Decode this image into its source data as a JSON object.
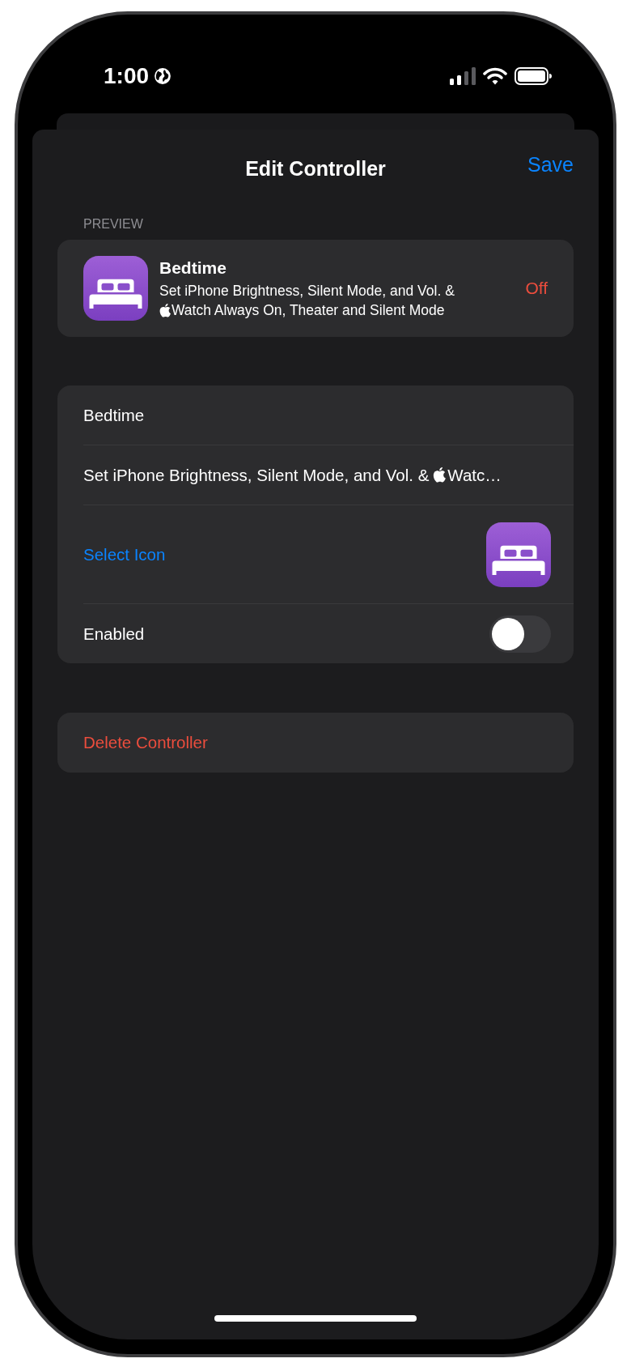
{
  "status_bar": {
    "time": "1:00"
  },
  "header": {
    "title": "Edit Controller",
    "save": "Save"
  },
  "preview": {
    "label": "PREVIEW",
    "title": "Bedtime",
    "before_logo": "Set iPhone Brightness, Silent Mode, and Vol. &",
    "after_logo": "Watch Always On, Theater and Silent Mode",
    "state": "Off"
  },
  "fields": [
    {
      "kind": "text",
      "value": "Bedtime"
    },
    {
      "kind": "text_logo",
      "before_logo": "Set iPhone Brightness, Silent Mode, and Vol. &",
      "after_logo": "Watc…"
    },
    {
      "kind": "icon_picker",
      "label": "Select Icon"
    },
    {
      "kind": "toggle",
      "label": "Enabled",
      "on": false
    }
  ],
  "delete_button": "Delete Controller"
}
